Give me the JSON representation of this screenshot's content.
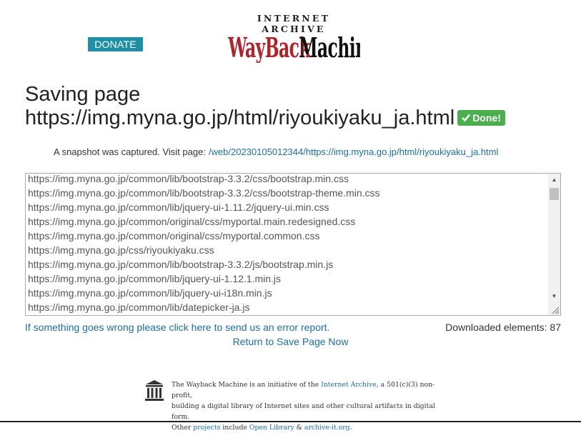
{
  "header": {
    "donate_label": "DONATE",
    "logo_top": "INTERNET ARCHIVE",
    "logo_main": "WayBackMachine"
  },
  "main": {
    "title_prefix": "Saving page",
    "title_url": "https://img.myna.go.jp/html/riyoukiyaku_ja.html",
    "done_label": "Done!",
    "snapshot_text": "A snapshot was captured. Visit page:",
    "snapshot_link": "/web/20230105012344/https://img.myna.go.jp/html/riyoukiyaku_ja.html",
    "resources": [
      "https://img.myna.go.jp/common/lib/bootstrap-3.3.2/css/bootstrap.min.css",
      "https://img.myna.go.jp/common/lib/bootstrap-3.3.2/css/bootstrap-theme.min.css",
      "https://img.myna.go.jp/common/lib/jquery-ui-1.11.2/jquery-ui.min.css",
      "https://img.myna.go.jp/common/original/css/myportal.main.redesigned.css",
      "https://img.myna.go.jp/common/original/css/myportal.common.css",
      "https://img.myna.go.jp/css/riyoukiyaku.css",
      "https://img.myna.go.jp/common/lib/bootstrap-3.3.2/js/bootstrap.min.js",
      "https://img.myna.go.jp/common/lib/jquery-ui-1.12.1.min.js",
      "https://img.myna.go.jp/common/lib/jquery-ui-i18n.min.js",
      "https://img.myna.go.jp/common/lib/datepicker-ja.js"
    ],
    "error_link": "If something goes wrong please click here to send us an error report.",
    "downloaded_label": "Downloaded elements: 87",
    "return_link": "Return to Save Page Now"
  },
  "footer": {
    "line1_a": "The Wayback Machine is an initiative of the",
    "line1_link": "Internet Archive",
    "line1_b": ", a 501(c)(3) non-profit,",
    "line2": "building a digital library of Internet sites and other cultural artifacts in digital form.",
    "line3_a": "Other",
    "line3_link1": "projects",
    "line3_b": "include",
    "line3_link2": "Open Library",
    "line3_amp": "&",
    "line3_link3": "archive-it.org",
    "line3_end": "."
  },
  "colors": {
    "donate_bg": "#1f8fa6",
    "done_bg": "#4cae4c",
    "link": "#1a6fa6",
    "logo_red": "#b0232a"
  },
  "icons": [
    "checkmark-icon",
    "archive-building-icon",
    "scroll-up-icon",
    "scroll-down-icon",
    "resize-grip-icon"
  ]
}
